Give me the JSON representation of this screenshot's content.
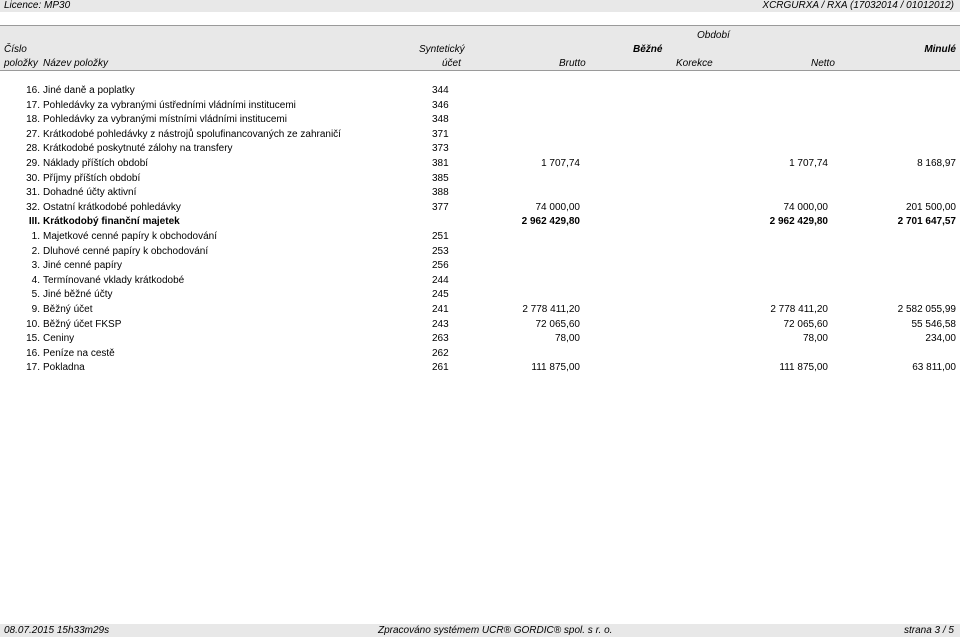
{
  "topbar": {
    "license": "Licence: MP30",
    "org": "XCRGURXA / RXA  (17032014 / 01012012)"
  },
  "header": {
    "obdobi": "Období",
    "cislo": "Číslo",
    "synteticky": "Syntetický",
    "bezne": "Běžné",
    "minule": "Minulé",
    "polozky": "položky",
    "nazev": "Název položky",
    "ucet": "účet",
    "brutto": "Brutto",
    "korekce": "Korekce",
    "netto": "Netto"
  },
  "rows": [
    {
      "num": "16.",
      "name": "Jiné daně a poplatky",
      "ucet": "344",
      "brutto": "",
      "netto": "",
      "minule": "",
      "bold": false
    },
    {
      "num": "17.",
      "name": "Pohledávky za vybranými ústředními vládními institucemi",
      "ucet": "346",
      "brutto": "",
      "netto": "",
      "minule": "",
      "bold": false
    },
    {
      "num": "18.",
      "name": "Pohledávky za vybranými místními vládními institucemi",
      "ucet": "348",
      "brutto": "",
      "netto": "",
      "minule": "",
      "bold": false
    },
    {
      "num": "27.",
      "name": "Krátkodobé pohledávky z nástrojů spolufinancovaných ze zahraničí",
      "ucet": "371",
      "brutto": "",
      "netto": "",
      "minule": "",
      "bold": false
    },
    {
      "num": "28.",
      "name": "Krátkodobé poskytnuté zálohy na transfery",
      "ucet": "373",
      "brutto": "",
      "netto": "",
      "minule": "",
      "bold": false
    },
    {
      "num": "29.",
      "name": "Náklady příštích období",
      "ucet": "381",
      "brutto": "1 707,74",
      "netto": "1 707,74",
      "minule": "8 168,97",
      "bold": false
    },
    {
      "num": "30.",
      "name": "Příjmy příštích období",
      "ucet": "385",
      "brutto": "",
      "netto": "",
      "minule": "",
      "bold": false
    },
    {
      "num": "31.",
      "name": "Dohadné účty aktivní",
      "ucet": "388",
      "brutto": "",
      "netto": "",
      "minule": "",
      "bold": false
    },
    {
      "num": "32.",
      "name": "Ostatní krátkodobé pohledávky",
      "ucet": "377",
      "brutto": "74 000,00",
      "netto": "74 000,00",
      "minule": "201 500,00",
      "bold": false
    },
    {
      "num": "III.",
      "name": "Krátkodobý finanční majetek",
      "ucet": "",
      "brutto": "2 962 429,80",
      "netto": "2 962 429,80",
      "minule": "2 701 647,57",
      "bold": true
    },
    {
      "num": "1.",
      "name": "Majetkové cenné papíry k obchodování",
      "ucet": "251",
      "brutto": "",
      "netto": "",
      "minule": "",
      "bold": false
    },
    {
      "num": "2.",
      "name": "Dluhové cenné papíry k obchodování",
      "ucet": "253",
      "brutto": "",
      "netto": "",
      "minule": "",
      "bold": false
    },
    {
      "num": "3.",
      "name": "Jiné cenné papíry",
      "ucet": "256",
      "brutto": "",
      "netto": "",
      "minule": "",
      "bold": false
    },
    {
      "num": "4.",
      "name": "Termínované vklady krátkodobé",
      "ucet": "244",
      "brutto": "",
      "netto": "",
      "minule": "",
      "bold": false
    },
    {
      "num": "5.",
      "name": "Jiné běžné účty",
      "ucet": "245",
      "brutto": "",
      "netto": "",
      "minule": "",
      "bold": false
    },
    {
      "num": "9.",
      "name": "Běžný účet",
      "ucet": "241",
      "brutto": "2 778 411,20",
      "netto": "2 778 411,20",
      "minule": "2 582 055,99",
      "bold": false
    },
    {
      "num": "10.",
      "name": "Běžný účet FKSP",
      "ucet": "243",
      "brutto": "72 065,60",
      "netto": "72 065,60",
      "minule": "55 546,58",
      "bold": false
    },
    {
      "num": "15.",
      "name": "Ceniny",
      "ucet": "263",
      "brutto": "78,00",
      "netto": "78,00",
      "minule": "234,00",
      "bold": false
    },
    {
      "num": "16.",
      "name": "Peníze na cestě",
      "ucet": "262",
      "brutto": "",
      "netto": "",
      "minule": "",
      "bold": false
    },
    {
      "num": "17.",
      "name": "Pokladna",
      "ucet": "261",
      "brutto": "111 875,00",
      "netto": "111 875,00",
      "minule": "63 811,00",
      "bold": false
    }
  ],
  "footer": {
    "datetime": "08.07.2015 15h33m29s",
    "processed": "Zpracováno systémem UCR® GORDIC® spol. s  r. o.",
    "page": "strana 3 / 5"
  }
}
